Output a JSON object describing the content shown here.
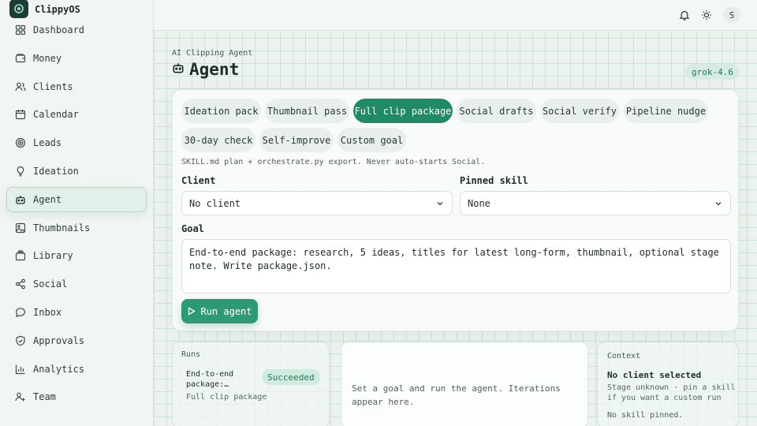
{
  "app": {
    "name": "ClippyOS"
  },
  "sidebar": {
    "items": [
      {
        "label": "Dashboard",
        "icon": "grid-icon"
      },
      {
        "label": "Money",
        "icon": "wallet-icon"
      },
      {
        "label": "Clients",
        "icon": "users-icon"
      },
      {
        "label": "Calendar",
        "icon": "calendar-icon"
      },
      {
        "label": "Leads",
        "icon": "target-icon"
      },
      {
        "label": "Ideation",
        "icon": "lightbulb-icon"
      },
      {
        "label": "Agent",
        "icon": "bot-icon",
        "active": true
      },
      {
        "label": "Thumbnails",
        "icon": "image-icon"
      },
      {
        "label": "Library",
        "icon": "library-icon"
      },
      {
        "label": "Social",
        "icon": "share-icon"
      },
      {
        "label": "Inbox",
        "icon": "chat-icon"
      },
      {
        "label": "Approvals",
        "icon": "shield-check-icon"
      },
      {
        "label": "Analytics",
        "icon": "bar-chart-icon"
      },
      {
        "label": "Team",
        "icon": "team-icon"
      }
    ]
  },
  "topbar": {
    "avatar_initial": "S",
    "icons": [
      "bell-icon",
      "sun-icon"
    ]
  },
  "header": {
    "eyebrow": "AI Clipping Agent",
    "title": "Agent",
    "model": "grok-4.6"
  },
  "presets": [
    {
      "label": "Ideation pack"
    },
    {
      "label": "Thumbnail pass"
    },
    {
      "label": "Full clip package",
      "active": true
    },
    {
      "label": "Social drafts"
    },
    {
      "label": "Social verify"
    },
    {
      "label": "Pipeline nudge"
    },
    {
      "label": "30-day check"
    },
    {
      "label": "Self-improve"
    },
    {
      "label": "Custom goal"
    }
  ],
  "hint": "SKILL.md plan + orchestrate.py export. Never auto-starts Social.",
  "form": {
    "client_label": "Client",
    "client_value": "No client",
    "skill_label": "Pinned skill",
    "skill_value": "None",
    "goal_label": "Goal",
    "goal_value": "End-to-end package: research, 5 ideas, titles for latest long-form, thumbnail, optional stage note. Write package.json.",
    "run_label": "Run agent"
  },
  "runs": {
    "title": "Runs",
    "items": [
      {
        "title": "End-to-end package:…",
        "subtitle": "Full clip package",
        "status": "Succeeded"
      }
    ]
  },
  "iterations": {
    "empty": "Set a goal and run the agent. Iterations appear here."
  },
  "context": {
    "title": "Context",
    "client": "No client selected",
    "description": "Stage unknown · pin a skill if you want a custom run",
    "skill": "No skill pinned."
  },
  "colors": {
    "accent": "#1f8a66",
    "accent_soft": "#d7ebe2",
    "sidebar_bg": "#f1f5f3"
  }
}
